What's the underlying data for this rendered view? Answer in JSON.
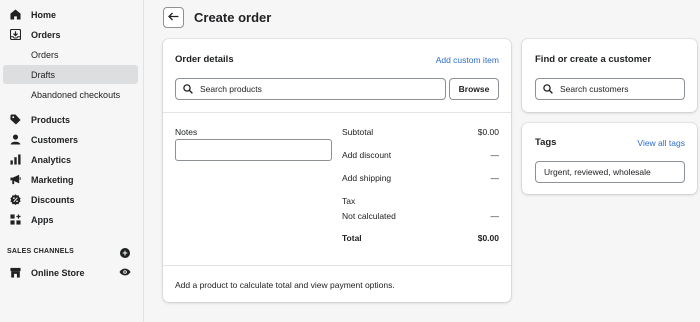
{
  "sidebar": {
    "items": [
      {
        "label": "Home",
        "icon": "home-icon"
      },
      {
        "label": "Orders",
        "icon": "orders-icon"
      },
      {
        "label": "Products",
        "icon": "tag-icon"
      },
      {
        "label": "Customers",
        "icon": "person-icon"
      },
      {
        "label": "Analytics",
        "icon": "bar-chart-icon"
      },
      {
        "label": "Marketing",
        "icon": "megaphone-icon"
      },
      {
        "label": "Discounts",
        "icon": "discount-icon"
      },
      {
        "label": "Apps",
        "icon": "apps-icon"
      }
    ],
    "sub_items": [
      {
        "label": "Orders"
      },
      {
        "label": "Drafts",
        "active": true
      },
      {
        "label": "Abandoned checkouts"
      }
    ],
    "sales_channels_title": "SALES CHANNELS",
    "online_store": "Online Store"
  },
  "header": {
    "title": "Create order"
  },
  "order_details": {
    "title": "Order details",
    "add_custom_item": "Add custom item",
    "search_placeholder": "Search products",
    "browse": "Browse",
    "notes_label": "Notes",
    "notes_value": "",
    "summary": {
      "subtotal_label": "Subtotal",
      "subtotal_value": "$0.00",
      "add_discount": "Add discount",
      "discount_value": "—",
      "add_shipping": "Add shipping",
      "shipping_value": "—",
      "tax_label": "Tax",
      "tax_sub": "Not calculated",
      "tax_value": "—",
      "total_label": "Total",
      "total_value": "$0.00"
    },
    "footer_text": "Add a product to calculate total and view payment options."
  },
  "customer": {
    "title": "Find or create a customer",
    "search_placeholder": "Search customers"
  },
  "tags": {
    "title": "Tags",
    "view_all": "View all tags",
    "value": "Urgent, reviewed, wholesale"
  },
  "colors": {
    "link": "#2c6ecb",
    "text": "#202223",
    "background": "#f6f6f7",
    "active_nav": "#dcdee0"
  }
}
